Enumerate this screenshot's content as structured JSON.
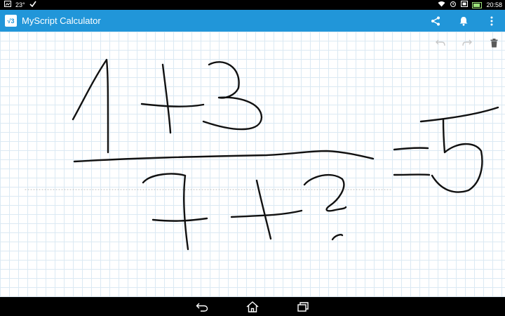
{
  "status_bar": {
    "left": {
      "temperature": "23°",
      "icons": [
        "gallery-notification-icon",
        "check-icon"
      ]
    },
    "right": {
      "icons": [
        "wifi-icon",
        "alarm-icon",
        "screenshot-icon"
      ],
      "time": "20:58"
    }
  },
  "app_bar": {
    "title": "MyScript Calculator",
    "logo_text": "√3",
    "actions": [
      "share-icon",
      "notifications-icon",
      "more-options-icon"
    ]
  },
  "canvas": {
    "tools": [
      "undo-icon",
      "redo-icon",
      "delete-icon"
    ]
  },
  "nav_bar": {
    "buttons": [
      "back-icon",
      "home-icon",
      "recent-apps-icon"
    ]
  },
  "colors": {
    "app_bar": "#2196d9",
    "grid": "#dbe9f3",
    "ink": "#111111"
  }
}
